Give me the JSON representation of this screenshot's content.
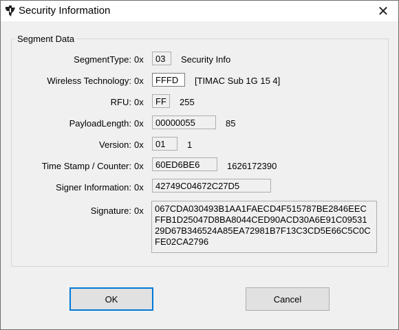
{
  "window": {
    "title": "Security Information",
    "icon": "ti-logo-icon",
    "close_glyph": "✕"
  },
  "group": {
    "label": "Segment Data"
  },
  "rows": {
    "segment_type": {
      "label": "SegmentType:",
      "prefix": "0x",
      "value": "03",
      "decoded": "Security Info"
    },
    "wireless_tech": {
      "label": "Wireless Technology:",
      "prefix": "0x",
      "value": "FFFD",
      "decoded": "[TIMAC Sub 1G 15 4]"
    },
    "rfu": {
      "label": "RFU:",
      "prefix": "0x",
      "value": "FF",
      "decoded": "255"
    },
    "payload_length": {
      "label": "PayloadLength:",
      "prefix": "0x",
      "value": "00000055",
      "decoded": "85"
    },
    "version": {
      "label": "Version:",
      "prefix": "0x",
      "value": "01",
      "decoded": "1"
    },
    "timestamp": {
      "label": "Time Stamp / Counter:",
      "prefix": "0x",
      "value": "60ED6BE6",
      "decoded": "1626172390"
    },
    "signer": {
      "label": "Signer Information:",
      "prefix": "0x",
      "value": "42749C04672C27D5"
    },
    "signature": {
      "label": "Signature:",
      "prefix": "0x",
      "value": "067CDA030493B1AA1FAECD4F515787BE2846EEC\nFFB1D25047D8BA8044CED90ACD30A6E91C09531\n29D67B346524A85EA72981B7F13C3CD5E66C5C0C\nFE02CA2796"
    }
  },
  "buttons": {
    "ok": "OK",
    "cancel": "Cancel"
  },
  "colors": {
    "accent": "#0078d7",
    "ti_logo": "#222222"
  }
}
